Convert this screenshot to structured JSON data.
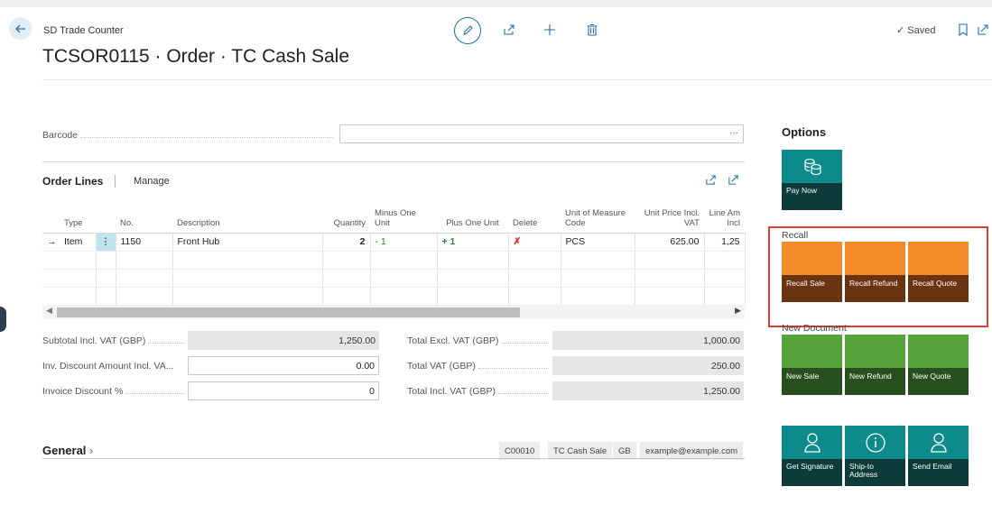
{
  "header": {
    "breadcrumb": "SD Trade Counter",
    "title": "TCSOR0115 · Order · TC Cash Sale",
    "saved": "Saved"
  },
  "barcode": {
    "label": "Barcode",
    "menu": "···"
  },
  "order_lines": {
    "title": "Order Lines",
    "manage": "Manage",
    "columns": [
      "Type",
      "No.",
      "Description",
      "Quantity",
      "Minus One Unit",
      "Plus One Unit",
      "Delete",
      "Unit of Measure Code",
      "Unit Price Incl. VAT",
      "Line Am Incl"
    ],
    "rows": [
      {
        "type": "Item",
        "no": "1150",
        "description": "Front Hub",
        "quantity": "2",
        "minus": "- 1",
        "plus": "+ 1",
        "delete": "✗",
        "uom": "PCS",
        "unit_price": "625.00",
        "line_amount": "1,25"
      }
    ]
  },
  "totals": {
    "subtotal_label": "Subtotal Incl. VAT (GBP)",
    "subtotal": "1,250.00",
    "inv_disc_label": "Inv. Discount Amount Incl. VA...",
    "inv_disc": "0.00",
    "inv_disc_pct_label": "Invoice Discount %",
    "inv_disc_pct": "0",
    "excl_vat_label": "Total Excl. VAT (GBP)",
    "excl_vat": "1,000.00",
    "vat_label": "Total VAT (GBP)",
    "vat": "250.00",
    "incl_vat_label": "Total Incl. VAT (GBP)",
    "incl_vat": "1,250.00"
  },
  "general": {
    "title": "General",
    "chips": [
      "C00010",
      "TC Cash Sale",
      "GB",
      "example@example.com"
    ]
  },
  "options": {
    "title": "Options",
    "pay_now": "Pay Now",
    "recall_label": "Recall",
    "recall_sale": "Recall Sale",
    "recall_refund": "Recall Refund",
    "recall_quote": "Recall Quote",
    "new_doc_label": "New Document",
    "new_sale": "New Sale",
    "new_refund": "New Refund",
    "new_quote": "New Quote",
    "get_signature": "Get Signature",
    "ship_to": "Ship-to Address",
    "send_email": "Send Email"
  },
  "colors": {
    "teal": "#0e8a8c",
    "orange": "#f58a28",
    "green": "#56a33a",
    "highlight": "#e53935"
  }
}
